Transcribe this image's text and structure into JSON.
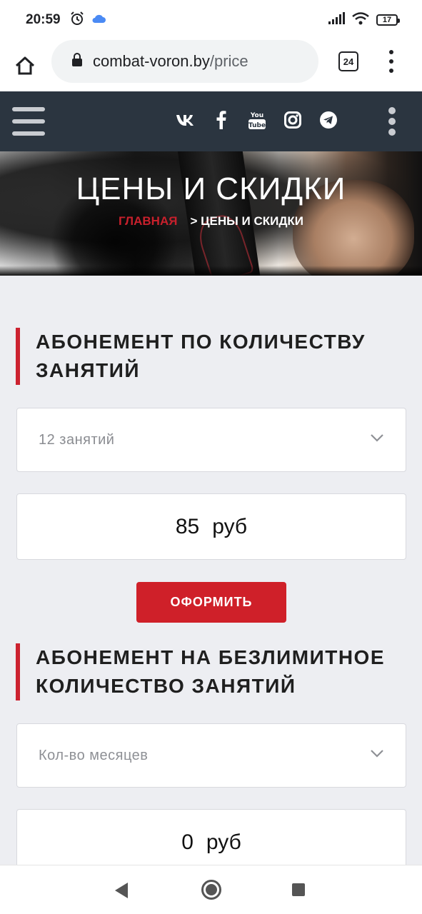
{
  "status_bar": {
    "time": "20:59",
    "battery": "17",
    "icons": [
      "alarm-icon",
      "cloud-icon",
      "signal-icon",
      "wifi-icon",
      "battery-icon"
    ]
  },
  "browser": {
    "url_domain": "combat-voron.by",
    "url_path": "/price",
    "tab_count": "24"
  },
  "site_header": {
    "socials": [
      "vk-icon",
      "facebook-icon",
      "youtube-icon",
      "instagram-icon",
      "telegram-icon"
    ],
    "youtube_label": "You Tube"
  },
  "hero": {
    "title": "ЦЕНЫ И СКИДКИ",
    "breadcrumb_home": "ГЛАВНАЯ",
    "breadcrumb_sep": ">",
    "breadcrumb_current": "ЦЕНЫ И СКИДКИ"
  },
  "sections": [
    {
      "title": "АБОНЕМЕНТ ПО КОЛИЧЕСТВУ ЗАНЯТИЙ",
      "select_value": "12 занятий",
      "price_value": "85",
      "price_unit": "руб",
      "button_label": "ОФОРМИТЬ"
    },
    {
      "title": "АБОНЕМЕНТ НА БЕЗЛИМИТНОЕ КОЛИЧЕСТВО ЗАНЯТИЙ",
      "select_placeholder": "Кол-во месяцев",
      "price_value": "0",
      "price_unit": "руб"
    }
  ],
  "colors": {
    "accent_red": "#cf2029",
    "header_bg": "#2b3540",
    "page_bg": "#edeef2"
  }
}
